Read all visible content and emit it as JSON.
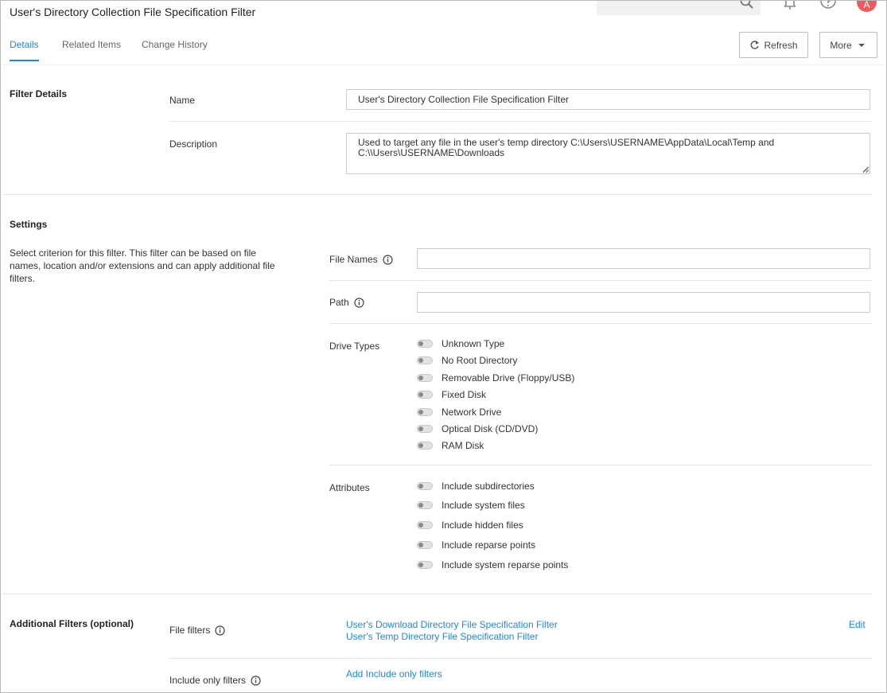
{
  "header": {
    "title": "User's Directory Collection File Specification Filter",
    "avatar_letter": "A",
    "accent_color": "#1e88e5"
  },
  "tabs": [
    {
      "label": "Details",
      "active": true
    },
    {
      "label": "Related Items",
      "active": false
    },
    {
      "label": "Change History",
      "active": false
    }
  ],
  "toolbar": {
    "refresh_label": "Refresh",
    "more_label": "More"
  },
  "filter_details": {
    "section_title": "Filter Details",
    "name_label": "Name",
    "name_value": "User's Directory Collection File Specification Filter",
    "description_label": "Description",
    "description_value": "Used to target any file in the user's temp directory C:\\Users\\USERNAME\\AppData\\Local\\Temp and C:\\\\Users\\USERNAME\\Downloads"
  },
  "settings": {
    "section_title": "Settings",
    "description": "Select criterion for this filter. This filter can be based on file names, location and/or extensions and can apply additional file filters.",
    "file_names_label": "File Names",
    "file_names_value": "",
    "path_label": "Path",
    "path_value": "",
    "drive_types_label": "Drive Types",
    "drive_types": [
      {
        "label": "Unknown Type",
        "on": false
      },
      {
        "label": "No Root Directory",
        "on": false
      },
      {
        "label": "Removable Drive (Floppy/USB)",
        "on": false
      },
      {
        "label": "Fixed Disk",
        "on": false
      },
      {
        "label": "Network Drive",
        "on": false
      },
      {
        "label": "Optical Disk (CD/DVD)",
        "on": false
      },
      {
        "label": "RAM Disk",
        "on": false
      }
    ],
    "attributes_label": "Attributes",
    "attributes": [
      {
        "label": "Include subdirectories",
        "on": false
      },
      {
        "label": "Include system files",
        "on": false
      },
      {
        "label": "Include hidden files",
        "on": false
      },
      {
        "label": "Include reparse points",
        "on": false
      },
      {
        "label": "Include system reparse points",
        "on": false
      }
    ]
  },
  "additional_filters": {
    "section_title": "Additional Filters (optional)",
    "file_filters_label": "File filters",
    "file_filters": [
      "User's Download Directory File Specification Filter",
      "User's Temp Directory File Specification Filter"
    ],
    "edit_label": "Edit",
    "include_only_label": "Include only filters",
    "add_include_only_label": "Add Include only filters"
  }
}
